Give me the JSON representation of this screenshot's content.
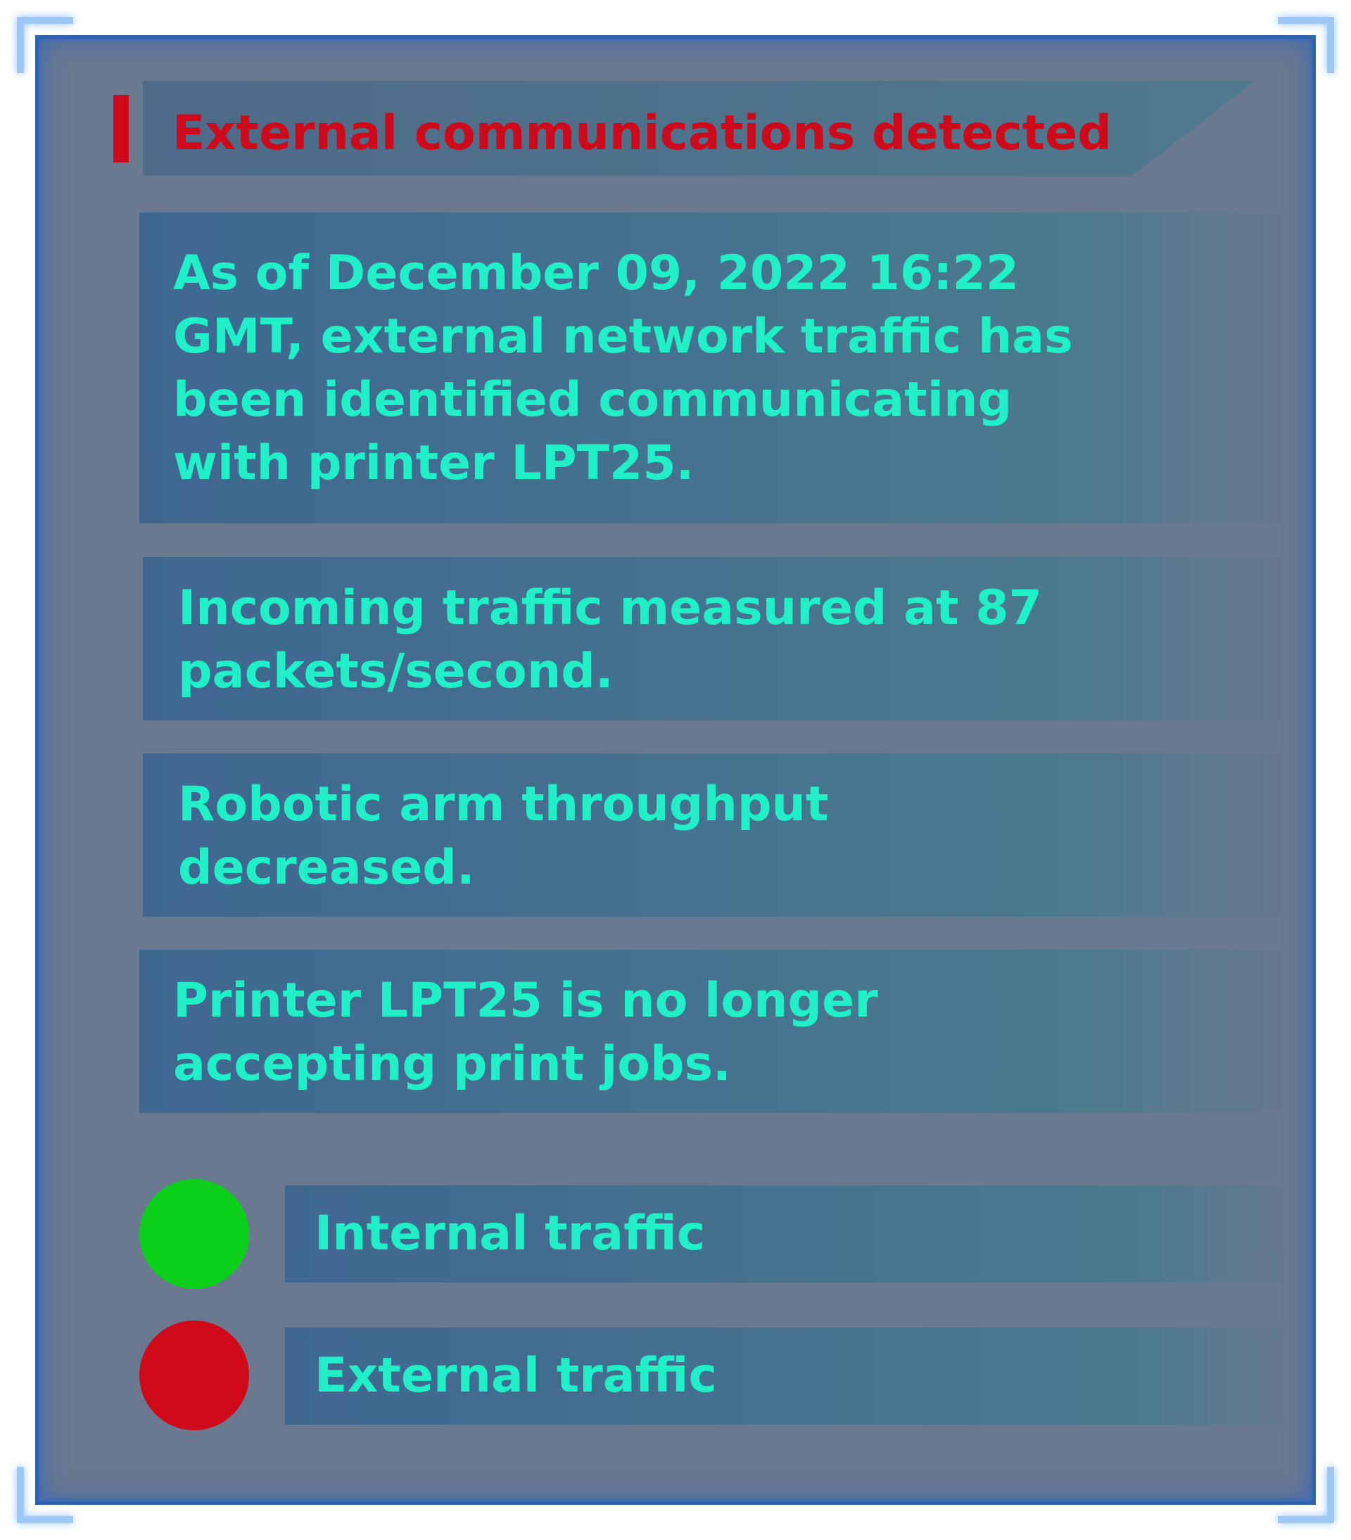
{
  "panel": {
    "title": "External communications detected",
    "colors": {
      "title": "#d0091a",
      "text": "#1ff0c8",
      "panel_border": "#2d63b0"
    }
  },
  "messages": [
    {
      "text": "As of December 09, 2022 16:22 GMT, external network traffic has been identified communicating with printer LPT25."
    },
    {
      "text": "Incoming traffic measured at 87 packets/second."
    },
    {
      "text": "Robotic arm throughput decreased."
    },
    {
      "text": "Printer LPT25 is no longer accepting print jobs."
    }
  ],
  "legend": [
    {
      "label": "Internal traffic",
      "color": "#0ad01a"
    },
    {
      "label": "External traffic",
      "color": "#d0091a"
    }
  ]
}
